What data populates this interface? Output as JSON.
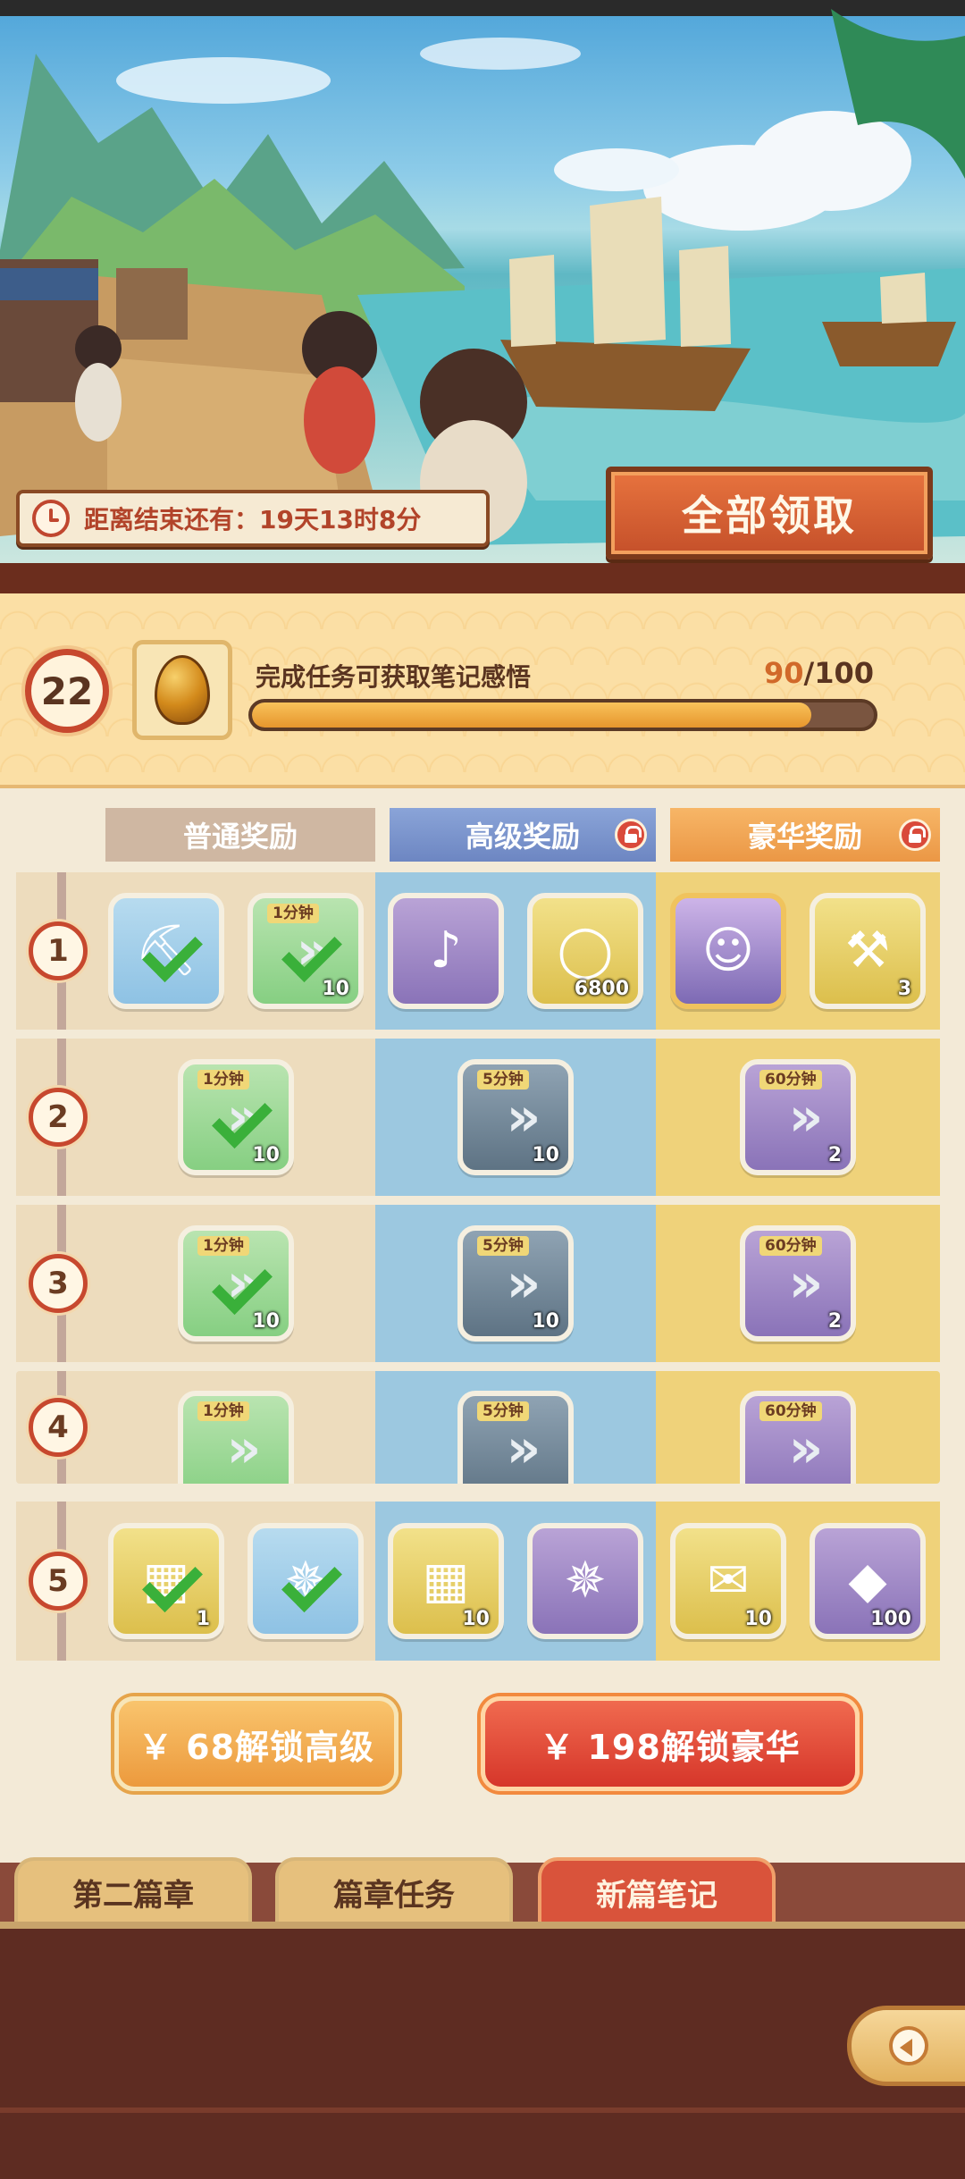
{
  "banner": {
    "timer_text": "距离结束还有：19天13时8分",
    "claim_all_label": "全部领取"
  },
  "progress": {
    "task_label": "完成任务可获取笔记感悟",
    "current": "90",
    "sep": "/",
    "total": "100",
    "level": "22",
    "fraction": 0.9
  },
  "columns": {
    "normal": "普通奖励",
    "advanced": "高级奖励",
    "luxury": "豪华奖励"
  },
  "rows": [
    {
      "num": "1",
      "normal": [
        {
          "icon": "shovel-icon",
          "claimed": true
        },
        {
          "icon": "speedup-icon",
          "badge": "1分钟",
          "qty": "10",
          "claimed": true
        }
      ],
      "advanced": [
        {
          "icon": "guitar-icon"
        },
        {
          "icon": "jade-ring-icon",
          "qty": "6800"
        }
      ],
      "luxury": [
        {
          "icon": "character-portrait-icon"
        },
        {
          "icon": "hammer-icon",
          "qty": "3"
        }
      ]
    },
    {
      "num": "2",
      "normal": [
        {
          "icon": "speedup-icon",
          "badge": "1分钟",
          "qty": "10",
          "claimed": true
        }
      ],
      "advanced": [
        {
          "icon": "speedup-icon",
          "badge": "5分钟",
          "qty": "10"
        }
      ],
      "luxury": [
        {
          "icon": "speedup-icon",
          "badge": "60分钟",
          "qty": "2"
        }
      ]
    },
    {
      "num": "3",
      "normal": [
        {
          "icon": "speedup-icon",
          "badge": "1分钟",
          "qty": "10",
          "claimed": true
        }
      ],
      "advanced": [
        {
          "icon": "speedup-icon",
          "badge": "5分钟",
          "qty": "10"
        }
      ],
      "luxury": [
        {
          "icon": "speedup-icon",
          "badge": "60分钟",
          "qty": "2"
        }
      ]
    },
    {
      "num": "4",
      "normal": [
        {
          "icon": "speedup-icon",
          "badge": "1分钟"
        }
      ],
      "advanced": [
        {
          "icon": "speedup-icon",
          "badge": "5分钟"
        }
      ],
      "luxury": [
        {
          "icon": "speedup-icon",
          "badge": "60分钟"
        }
      ]
    },
    {
      "num": "5",
      "normal": [
        {
          "icon": "scroll-card-icon",
          "qty": "1",
          "claimed": true
        },
        {
          "icon": "ship-wheel-icon",
          "claimed": true
        }
      ],
      "advanced": [
        {
          "icon": "scroll-card-icon",
          "qty": "10"
        },
        {
          "icon": "ship-wheel-icon"
        }
      ],
      "luxury": [
        {
          "icon": "envelope-icon",
          "qty": "10"
        },
        {
          "icon": "water-drop-icon",
          "qty": "100"
        }
      ]
    }
  ],
  "unlock": {
    "advanced": "￥ 68解锁高级",
    "luxury": "￥ 198解锁豪华"
  },
  "tabs": [
    {
      "label": "第二篇章",
      "active": false
    },
    {
      "label": "篇章任务",
      "active": false
    },
    {
      "label": "新篇笔记",
      "active": true
    }
  ]
}
